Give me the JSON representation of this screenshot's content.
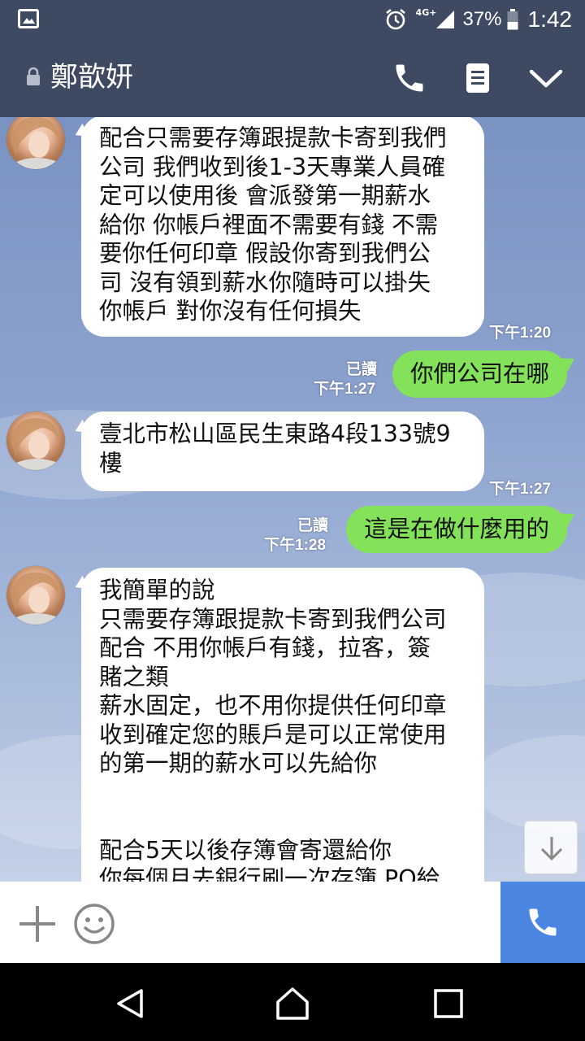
{
  "status_bar": {
    "network": "4G+",
    "battery": "37%",
    "battery_level": 0.37,
    "time": "1:42",
    "icons": [
      "gallery-icon",
      "alarm-icon",
      "signal-icon",
      "battery-icon"
    ]
  },
  "header": {
    "title": "鄭歆妍",
    "icons": [
      "lock-icon",
      "phone-icon",
      "notes-icon",
      "chevron-down-icon"
    ]
  },
  "messages": [
    {
      "side": "in",
      "text": "配合只需要存簿跟提款卡寄到我們\n公司 我們收到後1-3天專業人員確\n定可以使用後 會派發第一期薪水\n給你 你帳戶裡面不需要有錢 不需\n要你任何印章 假設你寄到我們公\n司 沒有領到薪水你隨時可以掛失\n你帳戶 對你沒有任何損失",
      "time": "下午1:20"
    },
    {
      "side": "out",
      "text": "你們公司在哪",
      "read": "已讀",
      "time": "下午1:27"
    },
    {
      "side": "in",
      "text": "壹北市松山區民生東路4段133號9\n樓",
      "time": "下午1:27"
    },
    {
      "side": "out",
      "text": "這是在做什麼用的",
      "read": "已讀",
      "time": "下午1:28"
    },
    {
      "side": "in",
      "text": "我簡單的說\n只需要存簿跟提款卡寄到我們公司\n配合 不用你帳戶有錢，拉客，簽\n賭之類\n薪水固定，也不用你提供任何印章\n收到確定您的賬戶是可以正常使用\n的第一期的薪水可以先給你\n\n\n配合5天以後存簿會寄還給你\n你每個月去銀行刷一次存簿 PO給"
    }
  ],
  "input_bar": {
    "icons": [
      "plus-icon",
      "emoji-icon",
      "phone-icon"
    ]
  },
  "nav_bar": {
    "icons": [
      "back-icon",
      "home-icon",
      "recents-icon"
    ]
  },
  "colors": {
    "header_bg": "#3e4a61",
    "outgoing_bubble": "#84e15a",
    "incoming_bubble": "#ffffff",
    "call_button": "#4b86e3"
  }
}
